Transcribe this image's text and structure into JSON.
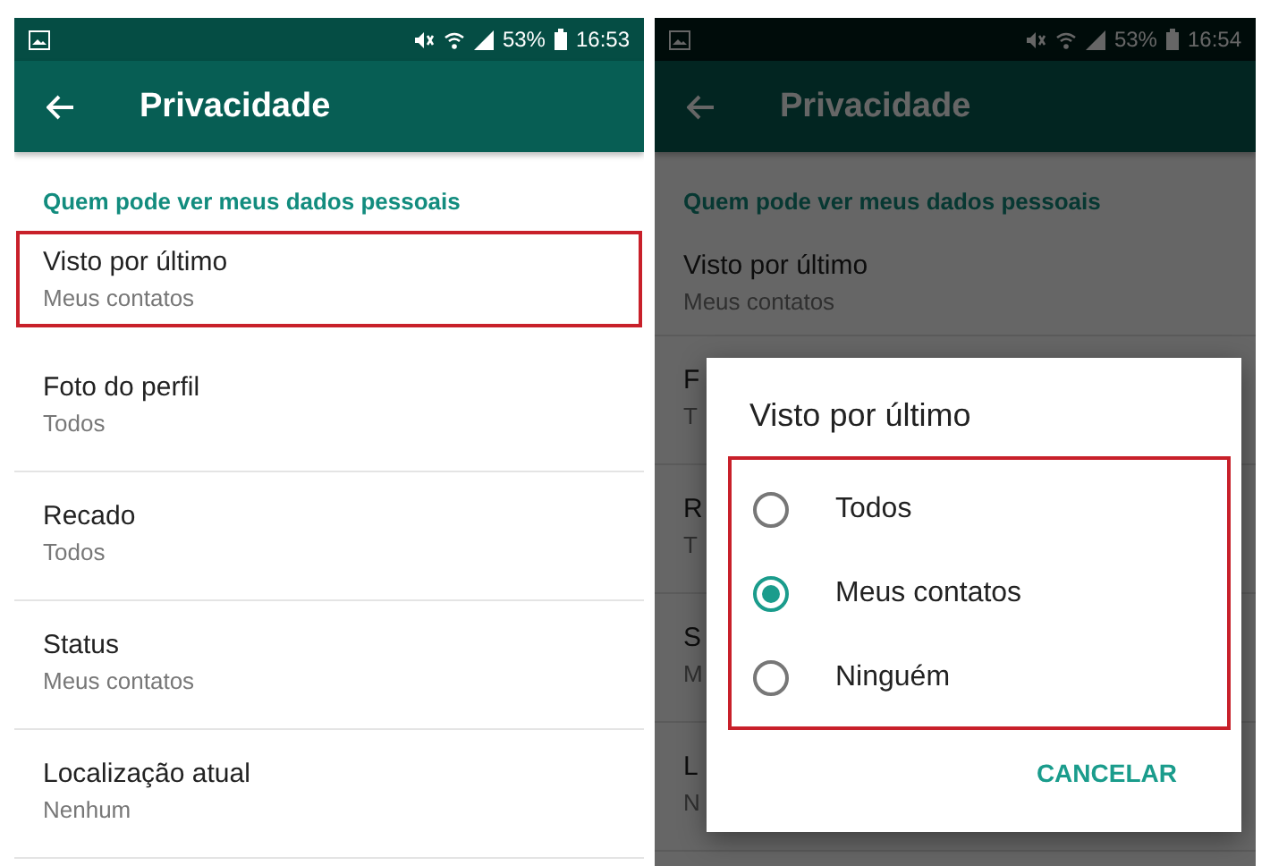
{
  "screens": [
    {
      "status_bar": {
        "battery": "53%",
        "time": "16:53"
      },
      "header": {
        "title": "Privacidade"
      },
      "dimmed": false,
      "section": "Quem pode ver meus dados pessoais",
      "items": [
        {
          "title": "Visto por último",
          "value": "Meus contatos",
          "highlighted": true
        },
        {
          "title": "Foto do perfil",
          "value": "Todos",
          "highlighted": false
        },
        {
          "title": "Recado",
          "value": "Todos",
          "highlighted": false
        },
        {
          "title": "Status",
          "value": "Meus contatos",
          "highlighted": false
        },
        {
          "title": "Localização atual",
          "value": "Nenhum",
          "highlighted": false
        }
      ]
    },
    {
      "status_bar": {
        "battery": "53%",
        "time": "16:54"
      },
      "header": {
        "title": "Privacidade"
      },
      "dimmed": true,
      "section": "Quem pode ver meus dados pessoais",
      "items": [
        {
          "title": "Visto por último",
          "value": "Meus contatos",
          "highlighted": false
        },
        {
          "title": "F",
          "value": "T",
          "highlighted": false
        },
        {
          "title": "R",
          "value": "T",
          "highlighted": false
        },
        {
          "title": "S",
          "value": "M",
          "highlighted": false
        },
        {
          "title": "L",
          "value": "N",
          "highlighted": false
        }
      ],
      "dialog": {
        "title": "Visto por último",
        "options_highlighted": true,
        "options": [
          {
            "label": "Todos",
            "selected": false
          },
          {
            "label": "Meus contatos",
            "selected": true
          },
          {
            "label": "Ninguém",
            "selected": false
          }
        ],
        "button": "CANCELAR"
      }
    }
  ]
}
